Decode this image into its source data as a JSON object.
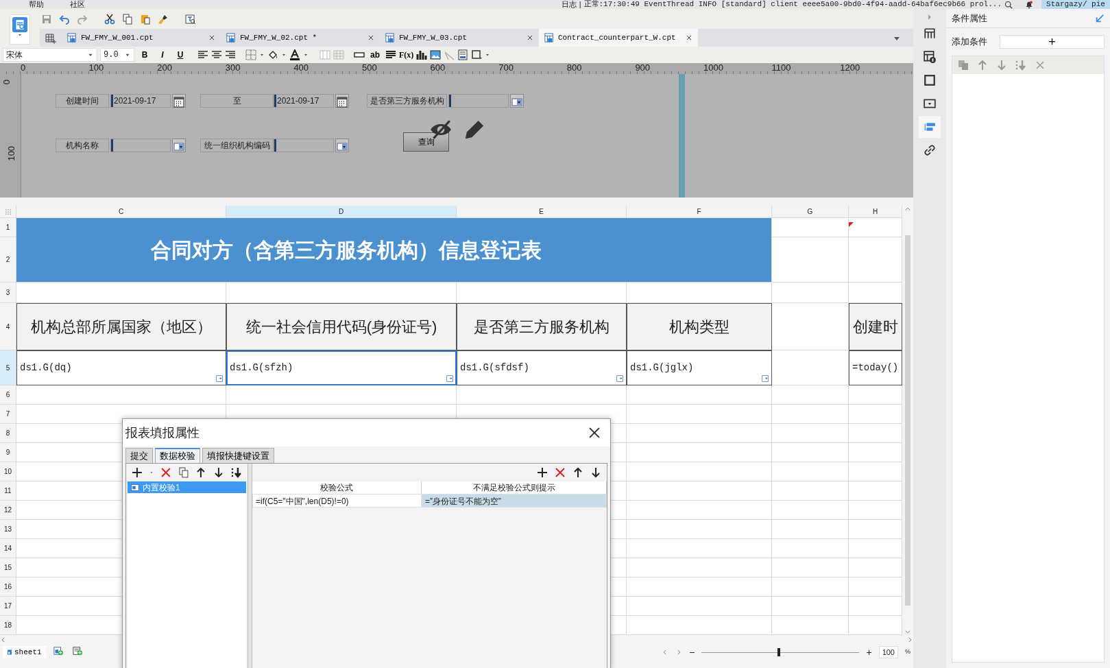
{
  "menu": [
    {
      "label": "帮助"
    },
    {
      "label": "社区"
    }
  ],
  "status": {
    "log": "日志",
    "separator": "|",
    "message": "正常:17:30:49 EventThread INFO [standard] client eeee5a00-9bd0-4f94-aadd-64baf6ec9b66 prol...",
    "user": "Stargazy/ pie"
  },
  "file_tabs": [
    {
      "label": "FW_FMY_W_001.cpt",
      "selected": false
    },
    {
      "label": "FW_FMY_W_02.cpt *",
      "selected": false
    },
    {
      "label": "FW_FMY_W_03.cpt",
      "selected": false
    },
    {
      "label": "Contract_counterpart_W.cpt",
      "selected": true
    }
  ],
  "format_bar": {
    "font": "宋体",
    "size": "9.0",
    "style_buttons": [
      "B",
      "I",
      "U"
    ],
    "text_tools": [
      "ab",
      "F(x)"
    ]
  },
  "ruler": {
    "x_labels": [
      "0",
      "100",
      "200",
      "300",
      "400",
      "500",
      "600",
      "700",
      "800",
      "900",
      "1000",
      "1100",
      "1200"
    ],
    "y_labels": [
      "0",
      "100"
    ]
  },
  "form": {
    "widgets": [
      {
        "kind": "label",
        "text": "创建时间"
      },
      {
        "kind": "date",
        "value": "2021-09-17"
      },
      {
        "kind": "label",
        "text": "至"
      },
      {
        "kind": "date",
        "value": "2021-09-17"
      },
      {
        "kind": "label",
        "text": "是否第三方服务机构"
      },
      {
        "kind": "combo"
      },
      {
        "kind": "label",
        "text": "机构名称"
      },
      {
        "kind": "combo"
      },
      {
        "kind": "label",
        "text": "统一组织机构编码"
      },
      {
        "kind": "combo"
      }
    ],
    "button": "查询"
  },
  "sheet": {
    "columns": [
      {
        "label": "C",
        "selected": false
      },
      {
        "label": "D",
        "selected": true
      },
      {
        "label": "E",
        "selected": false
      },
      {
        "label": "F",
        "selected": false
      },
      {
        "label": "G",
        "selected": false
      },
      {
        "label": "H",
        "selected": false
      }
    ],
    "rows": [
      {
        "label": "1",
        "selected": false
      },
      {
        "label": "2",
        "selected": false
      },
      {
        "label": "3",
        "selected": false
      },
      {
        "label": "4",
        "selected": false
      },
      {
        "label": "5",
        "selected": true
      },
      {
        "label": "6",
        "selected": false
      },
      {
        "label": "7",
        "selected": false
      },
      {
        "label": "8",
        "selected": false
      },
      {
        "label": "9",
        "selected": false
      },
      {
        "label": "10",
        "selected": false
      },
      {
        "label": "11",
        "selected": false
      },
      {
        "label": "12",
        "selected": false
      },
      {
        "label": "13",
        "selected": false
      },
      {
        "label": "14",
        "selected": false
      },
      {
        "label": "15",
        "selected": false
      },
      {
        "label": "16",
        "selected": false
      },
      {
        "label": "17",
        "selected": false
      },
      {
        "label": "18",
        "selected": false
      }
    ],
    "title": "合同对方（含第三方服务机构）信息登记表",
    "header_cells": [
      {
        "kind": "header",
        "text": "机构总部所属国家（地区）"
      },
      {
        "kind": "header",
        "text": "统一社会信用代码(身份证号)"
      },
      {
        "kind": "header",
        "text": "是否第三方服务机构"
      },
      {
        "kind": "header",
        "text": "机构类型"
      },
      {
        "kind": "blank"
      },
      {
        "kind": "header",
        "text": "创建时"
      }
    ],
    "data_cells": [
      {
        "kind": "data",
        "text": "ds1.G(dq)",
        "widget": true,
        "selected": false
      },
      {
        "kind": "data",
        "text": "ds1.G(sfzh)",
        "widget": true,
        "selected": true
      },
      {
        "kind": "data",
        "text": "ds1.G(sfdsf)",
        "widget": true,
        "selected": false
      },
      {
        "kind": "data",
        "text": "ds1.G(jglx)",
        "widget": true,
        "selected": false
      },
      {
        "kind": "blank"
      },
      {
        "kind": "data",
        "text": "=today()",
        "widget": false,
        "selected": false
      }
    ]
  },
  "dialog": {
    "title": "报表填报属性",
    "tabs": [
      {
        "label": "提交",
        "selected": false
      },
      {
        "label": "数据校验",
        "selected": true
      },
      {
        "label": "填报快捷键设置",
        "selected": false
      }
    ],
    "list": [
      {
        "label": "内置校验1",
        "selected": true
      }
    ],
    "columns": [
      "校验公式",
      "不满足校验公式则提示"
    ],
    "rows": [
      {
        "formula": "=if(C5=\"中国\",len(D5)!=0)",
        "message": "=”身份证号不能为空”",
        "selected": true
      }
    ]
  },
  "side_tools": [
    {
      "kind": "layout",
      "selected": false
    },
    {
      "kind": "cell-info",
      "selected": false
    },
    {
      "kind": "frame",
      "selected": false
    },
    {
      "kind": "widget",
      "selected": false
    },
    {
      "kind": "condition",
      "selected": true
    },
    {
      "kind": "link",
      "selected": false
    }
  ],
  "right_panel": {
    "title": "条件属性",
    "add_label": "添加条件",
    "add_button": "+"
  },
  "sheet_tabs": [
    {
      "label": "sheet1",
      "selected": true
    }
  ],
  "zoom": {
    "minus": "−",
    "plus": "+",
    "value": "100",
    "unit": "%",
    "level": 0.48
  }
}
